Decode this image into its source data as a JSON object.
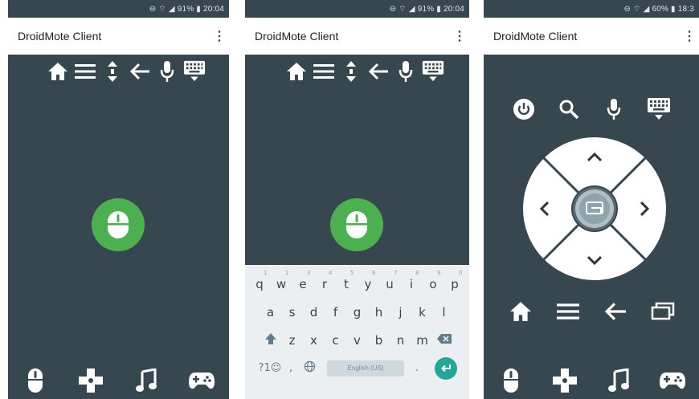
{
  "screens": [
    {
      "status": "⊖ ⌔ ◢ 91% ▮ 20:04",
      "title": "DroidMote Client",
      "menu_icon": "more-vert-icon",
      "toolbar": [
        "home-icon",
        "menu-icon",
        "scroll-icon",
        "back-icon",
        "mic-icon",
        "keyboard-icon"
      ],
      "center": "mouse-icon",
      "bottom_nav": [
        "mouse-icon",
        "dpad-icon",
        "music-icon",
        "gamepad-icon"
      ]
    },
    {
      "status": "⊖ ⌔ ◢ 91% ▮ 20:04",
      "title": "DroidMote Client",
      "menu_icon": "more-vert-icon",
      "toolbar": [
        "home-icon",
        "menu-icon",
        "scroll-icon",
        "back-icon",
        "mic-icon",
        "keyboard-icon"
      ],
      "center": "mouse-icon",
      "keyboard": {
        "row1": [
          "q",
          "w",
          "e",
          "r",
          "t",
          "y",
          "u",
          "i",
          "o",
          "p"
        ],
        "row1_hints": [
          "1",
          "2",
          "3",
          "4",
          "5",
          "6",
          "7",
          "8",
          "9",
          "0"
        ],
        "row2": [
          "a",
          "s",
          "d",
          "f",
          "g",
          "h",
          "j",
          "k",
          "l"
        ],
        "row3": [
          "z",
          "x",
          "c",
          "v",
          "b",
          "n",
          "m"
        ],
        "symbols_key": "?1☺",
        "comma_key": ",",
        "space_label": "English (US)",
        "period_key": "."
      }
    },
    {
      "status": "⊖ ⌔ ◢ 60% ▮ 18:3",
      "title": "DroidMote Client",
      "menu_icon": "more-vert-icon",
      "top_icons": [
        "power-icon",
        "search-icon",
        "mic-icon",
        "keyboard-icon"
      ],
      "dpad": [
        "up-icon",
        "left-icon",
        "right-icon",
        "down-icon",
        "ok-icon"
      ],
      "nav_icons": [
        "home-icon",
        "menu-icon",
        "back-icon",
        "recents-icon"
      ],
      "bottom_nav": [
        "mouse-icon",
        "dpad-icon",
        "music-icon",
        "gamepad-icon"
      ]
    }
  ],
  "colors": {
    "background": "#37474f",
    "accent_green": "#4caf50",
    "keyboard_bg": "#eceff1",
    "enter_teal": "#26a69a"
  }
}
